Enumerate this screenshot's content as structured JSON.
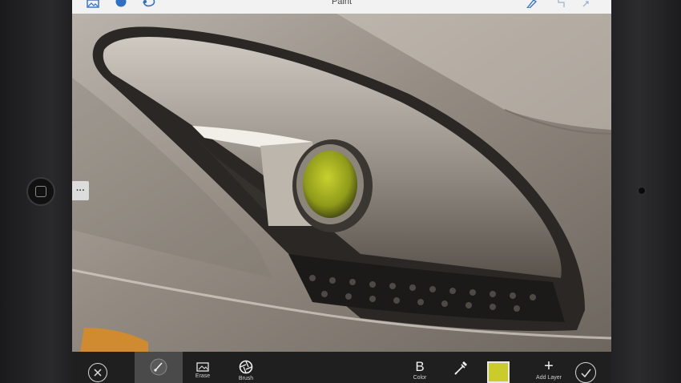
{
  "app": {
    "title": "Paint"
  },
  "canvas_menu": {
    "more_label": "···"
  },
  "toolbar": {
    "erase_label": "Erase",
    "brush_label": "Brush",
    "color_label": "Color",
    "color_letter": "B",
    "add_layer_label": "Add Layer",
    "add_symbol": "+"
  },
  "colors": {
    "selected_paint": "#c9cc2a",
    "toolbar_bg": "#1f1f1f",
    "topbar_bg": "#f2f2f2",
    "accent": "#2f6fc4"
  },
  "icons": {
    "topbar_left": [
      "image-icon",
      "circle-brush-icon",
      "lasso-icon"
    ],
    "topbar_right": [
      "pen-icon",
      "undo-icon",
      "expand-icon"
    ],
    "bottombar": [
      "cancel-icon",
      "paint-brush-icon",
      "erase-icon",
      "brush-icon",
      "color-letter",
      "eyedropper-icon",
      "color-swatch",
      "add-layer-icon",
      "done-icon"
    ]
  }
}
